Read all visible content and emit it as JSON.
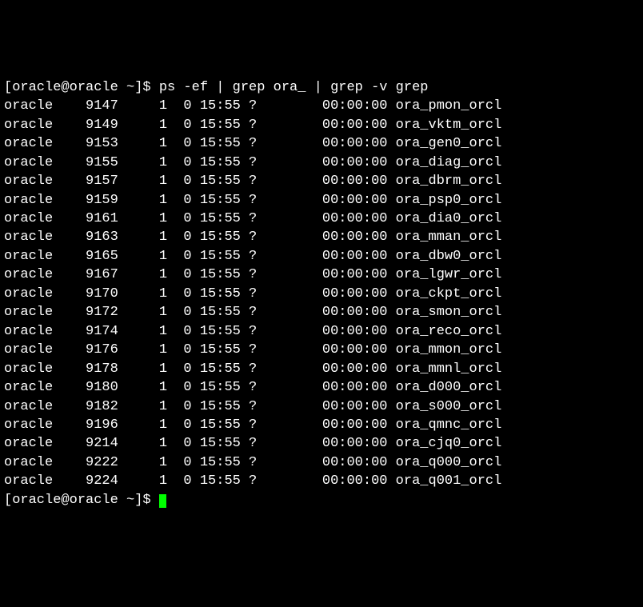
{
  "prompt_line1": {
    "full": "[oracle@oracle ~]$ ps -ef | grep ora_ | grep -v grep"
  },
  "processes": [
    {
      "uid": "oracle",
      "pid": "9147",
      "ppid": "1",
      "c": "0",
      "stime": "15:55",
      "tty": "?",
      "time": "00:00:00",
      "cmd": "ora_pmon_orcl"
    },
    {
      "uid": "oracle",
      "pid": "9149",
      "ppid": "1",
      "c": "0",
      "stime": "15:55",
      "tty": "?",
      "time": "00:00:00",
      "cmd": "ora_vktm_orcl"
    },
    {
      "uid": "oracle",
      "pid": "9153",
      "ppid": "1",
      "c": "0",
      "stime": "15:55",
      "tty": "?",
      "time": "00:00:00",
      "cmd": "ora_gen0_orcl"
    },
    {
      "uid": "oracle",
      "pid": "9155",
      "ppid": "1",
      "c": "0",
      "stime": "15:55",
      "tty": "?",
      "time": "00:00:00",
      "cmd": "ora_diag_orcl"
    },
    {
      "uid": "oracle",
      "pid": "9157",
      "ppid": "1",
      "c": "0",
      "stime": "15:55",
      "tty": "?",
      "time": "00:00:00",
      "cmd": "ora_dbrm_orcl"
    },
    {
      "uid": "oracle",
      "pid": "9159",
      "ppid": "1",
      "c": "0",
      "stime": "15:55",
      "tty": "?",
      "time": "00:00:00",
      "cmd": "ora_psp0_orcl"
    },
    {
      "uid": "oracle",
      "pid": "9161",
      "ppid": "1",
      "c": "0",
      "stime": "15:55",
      "tty": "?",
      "time": "00:00:00",
      "cmd": "ora_dia0_orcl"
    },
    {
      "uid": "oracle",
      "pid": "9163",
      "ppid": "1",
      "c": "0",
      "stime": "15:55",
      "tty": "?",
      "time": "00:00:00",
      "cmd": "ora_mman_orcl"
    },
    {
      "uid": "oracle",
      "pid": "9165",
      "ppid": "1",
      "c": "0",
      "stime": "15:55",
      "tty": "?",
      "time": "00:00:00",
      "cmd": "ora_dbw0_orcl"
    },
    {
      "uid": "oracle",
      "pid": "9167",
      "ppid": "1",
      "c": "0",
      "stime": "15:55",
      "tty": "?",
      "time": "00:00:00",
      "cmd": "ora_lgwr_orcl"
    },
    {
      "uid": "oracle",
      "pid": "9170",
      "ppid": "1",
      "c": "0",
      "stime": "15:55",
      "tty": "?",
      "time": "00:00:00",
      "cmd": "ora_ckpt_orcl"
    },
    {
      "uid": "oracle",
      "pid": "9172",
      "ppid": "1",
      "c": "0",
      "stime": "15:55",
      "tty": "?",
      "time": "00:00:00",
      "cmd": "ora_smon_orcl"
    },
    {
      "uid": "oracle",
      "pid": "9174",
      "ppid": "1",
      "c": "0",
      "stime": "15:55",
      "tty": "?",
      "time": "00:00:00",
      "cmd": "ora_reco_orcl"
    },
    {
      "uid": "oracle",
      "pid": "9176",
      "ppid": "1",
      "c": "0",
      "stime": "15:55",
      "tty": "?",
      "time": "00:00:00",
      "cmd": "ora_mmon_orcl"
    },
    {
      "uid": "oracle",
      "pid": "9178",
      "ppid": "1",
      "c": "0",
      "stime": "15:55",
      "tty": "?",
      "time": "00:00:00",
      "cmd": "ora_mmnl_orcl"
    },
    {
      "uid": "oracle",
      "pid": "9180",
      "ppid": "1",
      "c": "0",
      "stime": "15:55",
      "tty": "?",
      "time": "00:00:00",
      "cmd": "ora_d000_orcl"
    },
    {
      "uid": "oracle",
      "pid": "9182",
      "ppid": "1",
      "c": "0",
      "stime": "15:55",
      "tty": "?",
      "time": "00:00:00",
      "cmd": "ora_s000_orcl"
    },
    {
      "uid": "oracle",
      "pid": "9196",
      "ppid": "1",
      "c": "0",
      "stime": "15:55",
      "tty": "?",
      "time": "00:00:00",
      "cmd": "ora_qmnc_orcl"
    },
    {
      "uid": "oracle",
      "pid": "9214",
      "ppid": "1",
      "c": "0",
      "stime": "15:55",
      "tty": "?",
      "time": "00:00:00",
      "cmd": "ora_cjq0_orcl"
    },
    {
      "uid": "oracle",
      "pid": "9222",
      "ppid": "1",
      "c": "0",
      "stime": "15:55",
      "tty": "?",
      "time": "00:00:00",
      "cmd": "ora_q000_orcl"
    },
    {
      "uid": "oracle",
      "pid": "9224",
      "ppid": "1",
      "c": "0",
      "stime": "15:55",
      "tty": "?",
      "time": "00:00:00",
      "cmd": "ora_q001_orcl"
    }
  ],
  "prompt_line2": {
    "full": "[oracle@oracle ~]$ "
  }
}
